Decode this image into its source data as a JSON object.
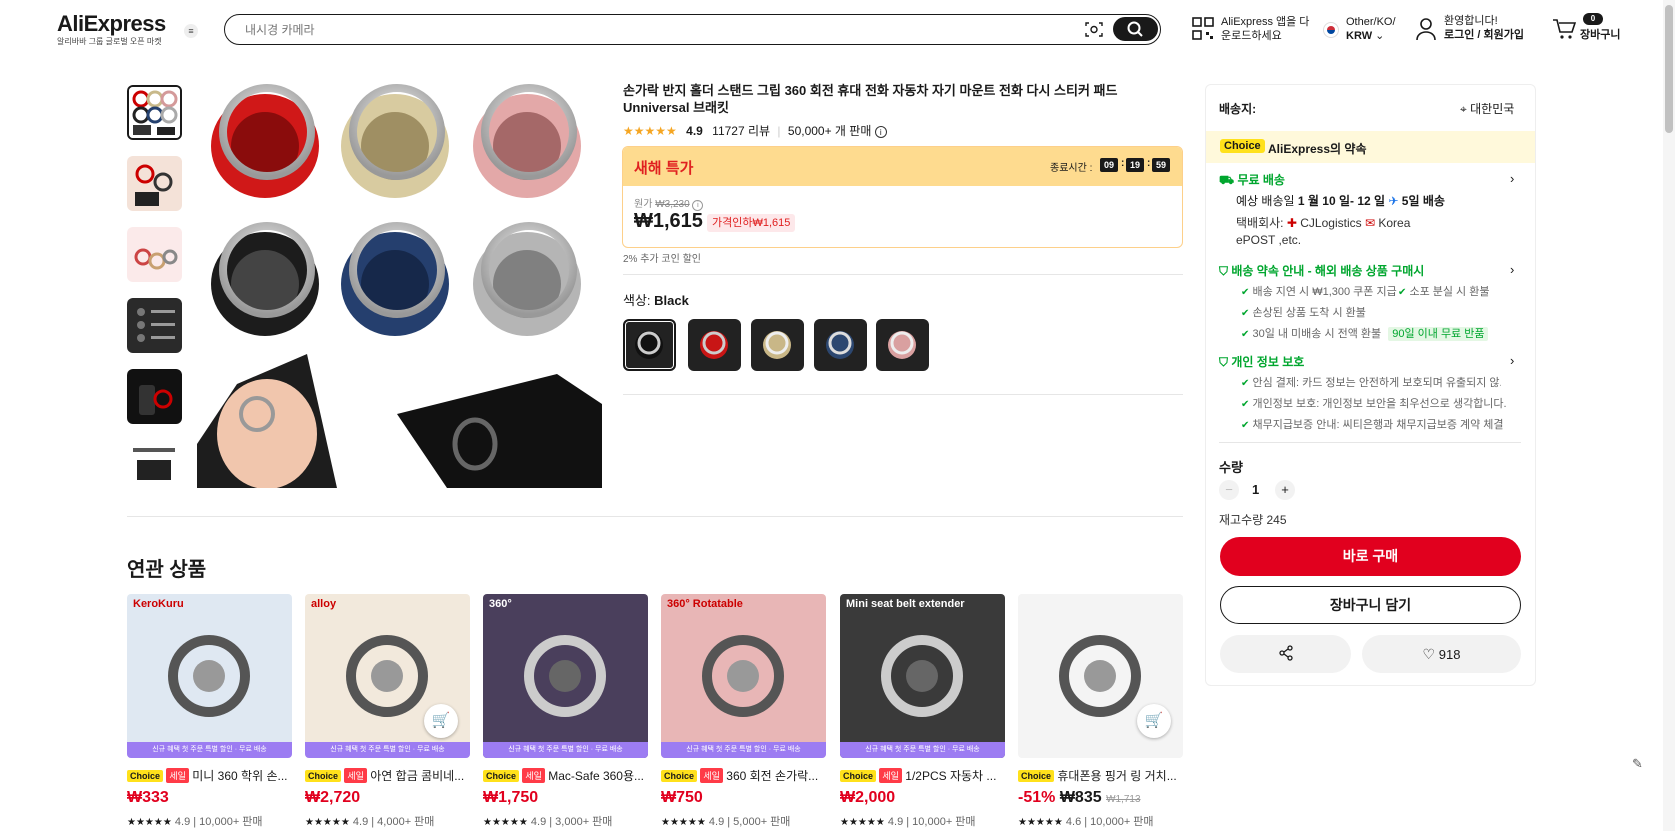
{
  "header": {
    "logo": "AliExpress",
    "logo_sub": "알리바바 그룹 글로벌 오픈 마켓",
    "search_placeholder": "내시경 카메라",
    "app_line1": "AliExpress 앱을 다",
    "app_line2": "운로드하세요",
    "region_line1": "Other/KO/",
    "region_currency": "KRW",
    "welcome": "환영합니다!",
    "login": "로그인 / 회원가입",
    "cart_count": "0",
    "cart_label": "장바구니"
  },
  "product": {
    "title": "손가락 반지 홀더 스탠드 그립 360 회전 휴대 전화 자동차 자기 마운트 전화 다시 스티커 패드 Unniversal 브래킷",
    "rating": "4.9",
    "reviews": "11727 리뷰",
    "sold": "50,000+ 개 판매",
    "sale_title": "새해 특가",
    "timer_label": "종료시간 :",
    "timer_h": "09",
    "timer_m": "19",
    "timer_s": "59",
    "orig_label": "원가",
    "orig_price": "₩3,230",
    "price": "₩1,615",
    "discount": "가격인하₩1,615",
    "coin": "2% 추가 코인 할인",
    "color_label": "색상: ",
    "color_value": "Black",
    "swatches": [
      "black",
      "red",
      "gold",
      "blue",
      "pink"
    ]
  },
  "panel": {
    "ship_to_label": "배송지:",
    "ship_to": "대한민국",
    "choice": "Choice",
    "promise": "AliExpress의 약속",
    "free_ship": "무료 배송",
    "est_prefix": "예상 배송일",
    "est_dates": "1 월 10 일- 12 일",
    "est_days": "5일 배송",
    "carrier_label": "택배회사:",
    "carrier1": "CJLogistics",
    "carrier2": "Korea",
    "carrier3": "ePOST ,etc.",
    "delivery_title": "배송 약속 안내 - 해외 배송 상품 구매시",
    "d1": "배송 지연 시 ₩1,300 쿠폰 지급",
    "d2": "소포 분실 시 환불",
    "d3": "손상된 상품 도착 시 환불",
    "d4": "30일 내 미배송 시 전액 환불",
    "d4_badge": "90일 이내 무료 반품",
    "privacy_title": "개인 정보 보호",
    "p1": "안심 결제: 카드 정보는 안전하게 보호되며 유출되지 않...",
    "p2": "개인정보 보호: 개인정보 보안을 최우선으로 생각합니다.",
    "p3": "채무지급보증 안내: 씨티은행과 채무지급보증 계약 체결",
    "qty_label": "수량",
    "qty": "1",
    "stock": "재고수량 245",
    "buy_now": "바로 구매",
    "add_cart": "장바구니 담기",
    "wish_count": "918"
  },
  "related": {
    "title": "연관 상품",
    "strip_text": "신규 혜택 첫 주문 특별 할인 · 무료 배송",
    "items": [
      {
        "choice": "Choice",
        "sale": "세일",
        "name": "미니 360 학위 손...",
        "price": "₩333",
        "orig": "",
        "pct": "",
        "rating": "4.9",
        "sold": "10,000+ 판매",
        "bg": "#dfe8f2",
        "brand": "KeroKuru"
      },
      {
        "choice": "Choice",
        "sale": "세일",
        "name": "아연 합금 콤비네...",
        "price": "₩2,720",
        "orig": "",
        "pct": "",
        "rating": "4.9",
        "sold": "4,000+ 판매",
        "bg": "#f2e9dc",
        "brand": "alloy"
      },
      {
        "choice": "Choice",
        "sale": "세일",
        "name": "Mac-Safe 360용...",
        "price": "₩1,750",
        "orig": "",
        "pct": "",
        "rating": "4.9",
        "sold": "3,000+ 판매",
        "bg": "#4a3f5c",
        "brand": "360°"
      },
      {
        "choice": "Choice",
        "sale": "세일",
        "name": "360 회전 손가락...",
        "price": "₩750",
        "orig": "",
        "pct": "",
        "rating": "4.9",
        "sold": "5,000+ 판매",
        "bg": "#e8b6b6",
        "brand": "360° Rotatable"
      },
      {
        "choice": "Choice",
        "sale": "세일",
        "name": "1/2PCS 자동차 ...",
        "price": "₩2,000",
        "orig": "",
        "pct": "",
        "rating": "4.9",
        "sold": "10,000+ 판매",
        "bg": "#3a3a3a",
        "brand": "Mini seat belt extender"
      },
      {
        "choice": "Choice",
        "sale": "",
        "name": "휴대폰용 핑거 링 거치...",
        "price": "₩835",
        "orig": "₩1,713",
        "pct": "-51%",
        "rating": "4.6",
        "sold": "10,000+ 판매",
        "bg": "#f4f4f4",
        "brand": ""
      }
    ]
  },
  "colors": {
    "accent_red": "#e1001e",
    "choice_yellow": "#ffe11b",
    "green": "#00a62e",
    "sale_header": "#fedb8f"
  }
}
